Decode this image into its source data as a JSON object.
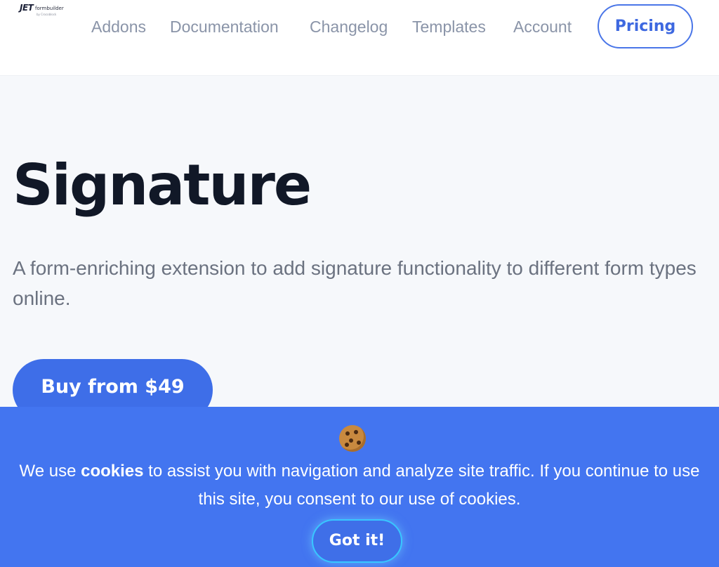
{
  "logo": {
    "brand": "JET",
    "product": "formbuilder",
    "byline": "by Crocoblock"
  },
  "nav": {
    "items": [
      {
        "label": "Addons"
      },
      {
        "label": "Documentation"
      },
      {
        "label": "Changelog"
      },
      {
        "label": "Templates"
      },
      {
        "label": "Account"
      }
    ],
    "pricing_label": "Pricing"
  },
  "hero": {
    "title": "Signature",
    "description": "A form-enriching extension to add signature functionality to different form types online.",
    "buy_label": "Buy from $49"
  },
  "cookie_banner": {
    "icon": "cookie-icon",
    "text_before": "We use ",
    "text_bold": "cookies",
    "text_after": " to assist you with navigation and analyze site traffic. If you continue to use this site, you consent to our use of cookies.",
    "accept_label": "Got it!"
  },
  "colors": {
    "accent": "#3e6ee8",
    "banner": "#4375f0",
    "title": "#111827",
    "nav_text": "#8a94a8"
  }
}
